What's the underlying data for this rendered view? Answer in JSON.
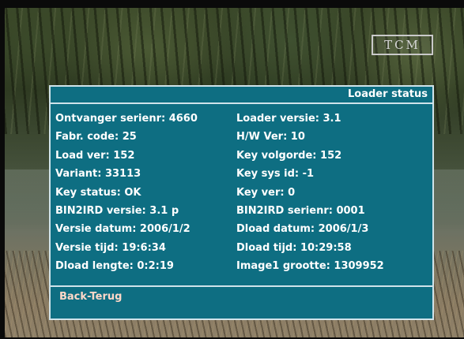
{
  "channel_logo": "TCM",
  "panel": {
    "title": "Loader status",
    "left_column": [
      "Ontvanger serienr: 4660",
      "Fabr. code: 25",
      "Load ver: 152",
      "Variant: 33113",
      "Key status: OK",
      "BIN2IRD versie: 3.1 p",
      "Versie datum: 2006/1/2",
      "Versie tijd: 19:6:34",
      "Dload lengte: 0:2:19"
    ],
    "right_column": [
      "Loader versie: 3.1",
      "H/W Ver: 10",
      "Key volgorde: 152",
      "Key sys id: -1",
      "Key ver: 0",
      "BIN2IRD serienr: 0001",
      "Dload datum: 2006/1/3",
      "Dload tijd: 10:29:58",
      "Image1 grootte: 1309952"
    ],
    "footer": {
      "back_label": "Back-Terug"
    }
  },
  "colors": {
    "panel_background": "#0e6e82",
    "panel_border": "#cfe3ea",
    "text": "#ffffff",
    "back_text": "#ffd8c8"
  }
}
